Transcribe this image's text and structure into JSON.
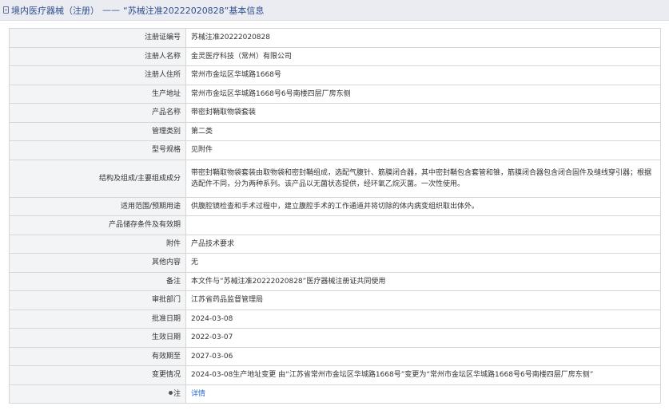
{
  "header": {
    "category": "境内医疗器械（注册）",
    "separator": "——",
    "record": "“苏械注准20222020828”",
    "suffix": "基本信息"
  },
  "rows": [
    {
      "label": "注册证编号",
      "value": "苏械注准20222020828"
    },
    {
      "label": "注册人名称",
      "value": "金灵医疗科技（常州）有限公司"
    },
    {
      "label": "注册人住所",
      "value": "常州市金坛区华城路1668号"
    },
    {
      "label": "生产地址",
      "value": "常州市金坛区华城路1668号6号南楼四层厂房东侧"
    },
    {
      "label": "产品名称",
      "value": "带密封鞘取物袋套装"
    },
    {
      "label": "管理类别",
      "value": "第二类"
    },
    {
      "label": "型号规格",
      "value": "见附件"
    },
    {
      "label": "结构及组成/主要组成成分",
      "value": "带密封鞘取物袋套装由取物袋和密封鞘组成，选配气腹针、筋膜闭合器，其中密封鞘包含套管和锥，筋膜闭合器包含闭合固件及缝线穿引器；根据选配件不同，分为两种系列。该产品以无菌状态提供，经环氧乙烷灭菌。一次性使用。"
    },
    {
      "label": "适用范围/预期用途",
      "value": "供腹腔镜检查和手术过程中，建立腹腔手术的工作通道并将切除的体内病变组织取出体外。"
    },
    {
      "label": "产品储存条件及有效期",
      "value": ""
    },
    {
      "label": "附件",
      "value": "产品技术要求"
    },
    {
      "label": "其他内容",
      "value": "无"
    },
    {
      "label": "备注",
      "value": "本文件与“苏械注准20222020828”医疗器械注册证共同使用"
    },
    {
      "label": "审批部门",
      "value": "江苏省药品监督管理局"
    },
    {
      "label": "批准日期",
      "value": "2024-03-08"
    },
    {
      "label": "生效日期",
      "value": "2022-03-07"
    },
    {
      "label": "有效期至",
      "value": "2027-03-06"
    },
    {
      "label": "变更情况",
      "value": "2024-03-08生产地址变更 由“江苏省常州市金坛区华城路1668号”变更为“常州市金坛区华城路1668号6号南楼四层厂房东侧”"
    }
  ],
  "note": {
    "label": "注",
    "icon": "info-dot-icon",
    "link_text": "详情",
    "link_color": "#2a6ad4"
  }
}
